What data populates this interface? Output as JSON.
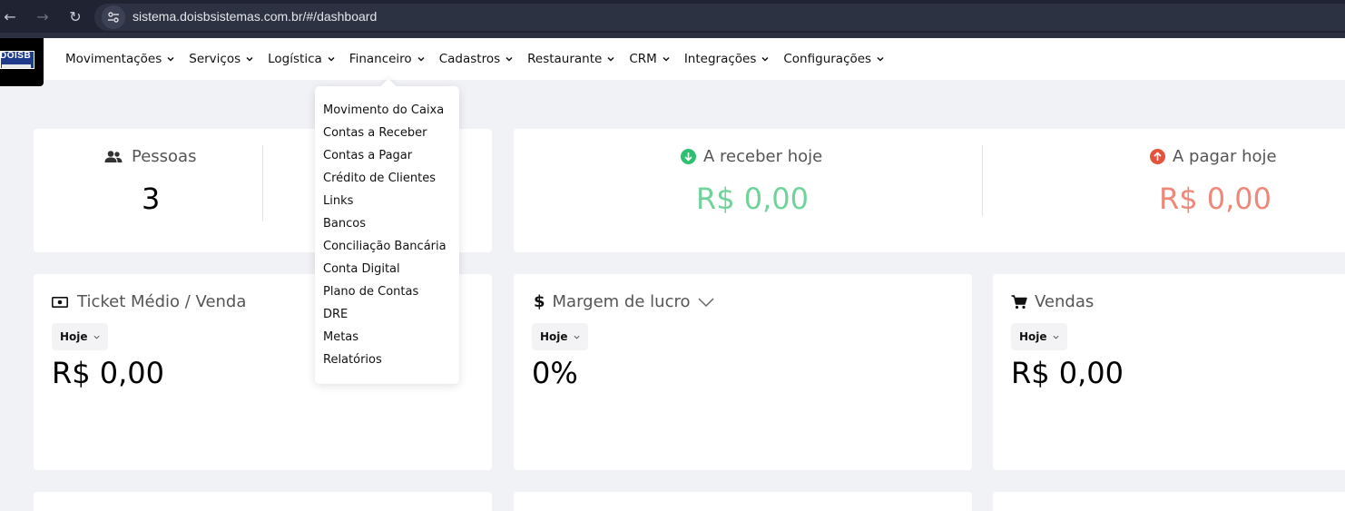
{
  "browser": {
    "url": "sistema.doisbsistemas.com.br/#/dashboard"
  },
  "logo": {
    "text": "DOISB"
  },
  "menu": [
    {
      "label": "Movimentações"
    },
    {
      "label": "Serviços"
    },
    {
      "label": "Logística"
    },
    {
      "label": "Financeiro"
    },
    {
      "label": "Cadastros"
    },
    {
      "label": "Restaurante"
    },
    {
      "label": "CRM"
    },
    {
      "label": "Integrações"
    },
    {
      "label": "Configurações"
    }
  ],
  "financeiro_dropdown": [
    {
      "label": "Movimento do Caixa"
    },
    {
      "label": "Contas a Receber"
    },
    {
      "label": "Contas a Pagar"
    },
    {
      "label": "Crédito de Clientes"
    },
    {
      "label": "Links"
    },
    {
      "label": "Bancos"
    },
    {
      "label": "Conciliação Bancária"
    },
    {
      "label": "Conta Digital"
    },
    {
      "label": "Plano de Contas"
    },
    {
      "label": "DRE"
    },
    {
      "label": "Metas"
    },
    {
      "label": "Relatórios"
    }
  ],
  "stats": {
    "pessoas": {
      "label": "Pessoas",
      "value": "3"
    },
    "receber": {
      "label": "A receber hoje",
      "value": "R$ 0,00"
    },
    "pagar": {
      "label": "A pagar hoje",
      "value": "R$ 0,00"
    }
  },
  "cards": {
    "ticket": {
      "title": "Ticket Médio / Venda",
      "filter": "Hoje",
      "value": "R$ 0,00"
    },
    "margem": {
      "title": "Margem de lucro",
      "filter": "Hoje",
      "value": "0%"
    },
    "vendas": {
      "title": "Vendas",
      "filter": "Hoje",
      "value": "R$ 0,00"
    }
  },
  "colors": {
    "receber": "#6fd39a",
    "pagar": "#ee8878",
    "receber_icon": "#2fbf71",
    "pagar_icon": "#e5533d"
  },
  "icons": {
    "back": "arrow-left-icon",
    "forward": "arrow-right-icon",
    "reload": "reload-icon",
    "site_info": "tune-icon",
    "pessoas": "users-icon",
    "receber": "arrow-down-circle-icon",
    "pagar": "arrow-up-circle-icon",
    "ticket": "money-icon",
    "margem": "dollar-icon",
    "vendas": "cart-icon"
  }
}
